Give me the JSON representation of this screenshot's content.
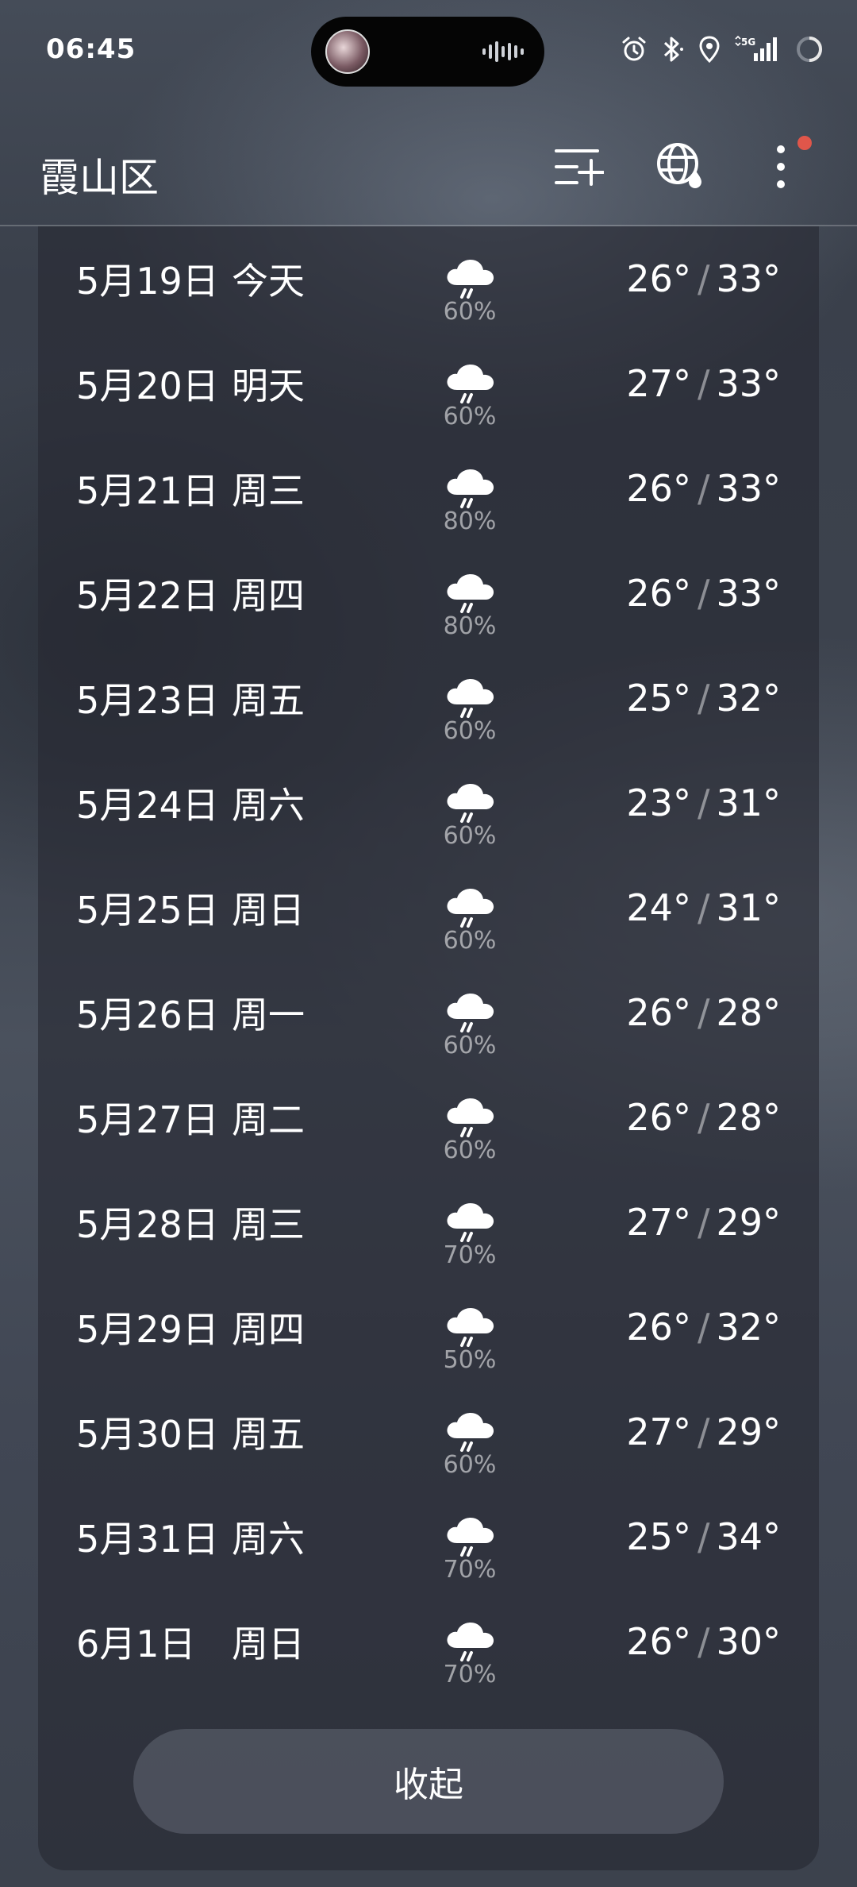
{
  "status_bar": {
    "time": "06:45",
    "network": "5G"
  },
  "header": {
    "location": "霞山区",
    "icons": [
      "add-city-icon",
      "globe-weather-icon",
      "more-vertical-icon"
    ]
  },
  "forecast": [
    {
      "date": "5月19日",
      "day": "今天",
      "precip": "60%",
      "low": "26°",
      "high": "33°"
    },
    {
      "date": "5月20日",
      "day": "明天",
      "precip": "60%",
      "low": "27°",
      "high": "33°"
    },
    {
      "date": "5月21日",
      "day": "周三",
      "precip": "80%",
      "low": "26°",
      "high": "33°"
    },
    {
      "date": "5月22日",
      "day": "周四",
      "precip": "80%",
      "low": "26°",
      "high": "33°"
    },
    {
      "date": "5月23日",
      "day": "周五",
      "precip": "60%",
      "low": "25°",
      "high": "32°"
    },
    {
      "date": "5月24日",
      "day": "周六",
      "precip": "60%",
      "low": "23°",
      "high": "31°"
    },
    {
      "date": "5月25日",
      "day": "周日",
      "precip": "60%",
      "low": "24°",
      "high": "31°"
    },
    {
      "date": "5月26日",
      "day": "周一",
      "precip": "60%",
      "low": "26°",
      "high": "28°"
    },
    {
      "date": "5月27日",
      "day": "周二",
      "precip": "60%",
      "low": "26°",
      "high": "28°"
    },
    {
      "date": "5月28日",
      "day": "周三",
      "precip": "70%",
      "low": "27°",
      "high": "29°"
    },
    {
      "date": "5月29日",
      "day": "周四",
      "precip": "50%",
      "low": "26°",
      "high": "32°"
    },
    {
      "date": "5月30日",
      "day": "周五",
      "precip": "60%",
      "low": "27°",
      "high": "29°"
    },
    {
      "date": "5月31日",
      "day": "周六",
      "precip": "70%",
      "low": "25°",
      "high": "34°"
    },
    {
      "date": "6月1日",
      "day": "周日",
      "precip": "70%",
      "low": "26°",
      "high": "30°"
    }
  ],
  "temp_separator": "/",
  "collapse_label": "收起",
  "colors": {
    "notify_dot": "#e0564a",
    "precip_text": "#9a9ea6"
  }
}
